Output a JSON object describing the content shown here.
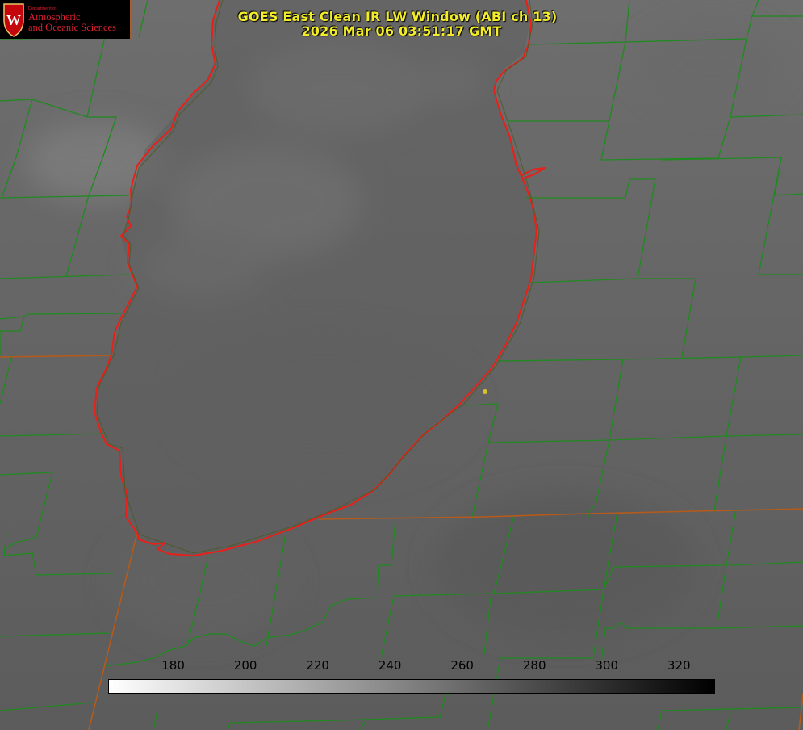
{
  "title": {
    "line1": "GOES East Clean IR LW Window (ABI ch 13)",
    "line2": "2026 Mar 06 03:51:17 GMT"
  },
  "logo": {
    "dept": "Department of",
    "line1": "Atmospheric",
    "line2": "and Oceanic Sciences",
    "crest_letter": "W"
  },
  "colorbar": {
    "min": 162,
    "max": 330,
    "ticks": [
      "180",
      "200",
      "220",
      "240",
      "260",
      "280",
      "300",
      "320"
    ]
  },
  "colors": {
    "title": "#f2ec2a",
    "county_lines": "#1f8a1f",
    "state_lines": "#b55a1a",
    "coastline": "#e8201a",
    "marker": "#d7c22a",
    "logo_red": "#d9202f"
  }
}
